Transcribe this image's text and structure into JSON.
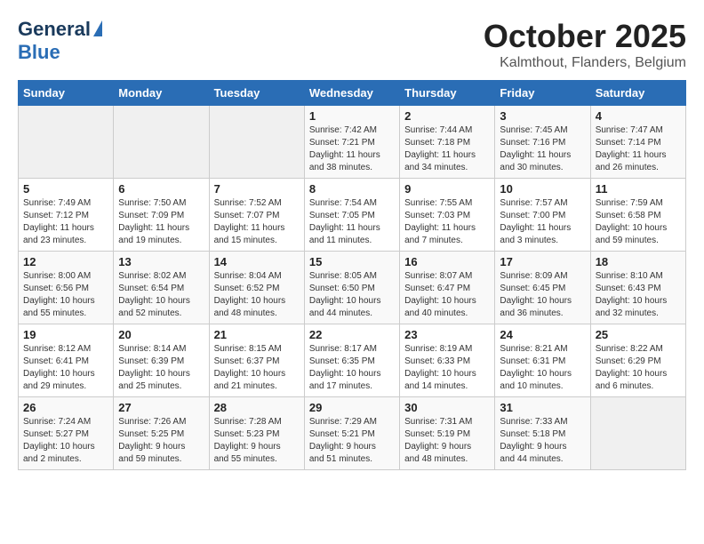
{
  "header": {
    "logo_line1": "General",
    "logo_line2": "Blue",
    "month": "October 2025",
    "location": "Kalmthout, Flanders, Belgium"
  },
  "weekdays": [
    "Sunday",
    "Monday",
    "Tuesday",
    "Wednesday",
    "Thursday",
    "Friday",
    "Saturday"
  ],
  "weeks": [
    [
      {
        "day": "",
        "info": ""
      },
      {
        "day": "",
        "info": ""
      },
      {
        "day": "",
        "info": ""
      },
      {
        "day": "1",
        "info": "Sunrise: 7:42 AM\nSunset: 7:21 PM\nDaylight: 11 hours\nand 38 minutes."
      },
      {
        "day": "2",
        "info": "Sunrise: 7:44 AM\nSunset: 7:18 PM\nDaylight: 11 hours\nand 34 minutes."
      },
      {
        "day": "3",
        "info": "Sunrise: 7:45 AM\nSunset: 7:16 PM\nDaylight: 11 hours\nand 30 minutes."
      },
      {
        "day": "4",
        "info": "Sunrise: 7:47 AM\nSunset: 7:14 PM\nDaylight: 11 hours\nand 26 minutes."
      }
    ],
    [
      {
        "day": "5",
        "info": "Sunrise: 7:49 AM\nSunset: 7:12 PM\nDaylight: 11 hours\nand 23 minutes."
      },
      {
        "day": "6",
        "info": "Sunrise: 7:50 AM\nSunset: 7:09 PM\nDaylight: 11 hours\nand 19 minutes."
      },
      {
        "day": "7",
        "info": "Sunrise: 7:52 AM\nSunset: 7:07 PM\nDaylight: 11 hours\nand 15 minutes."
      },
      {
        "day": "8",
        "info": "Sunrise: 7:54 AM\nSunset: 7:05 PM\nDaylight: 11 hours\nand 11 minutes."
      },
      {
        "day": "9",
        "info": "Sunrise: 7:55 AM\nSunset: 7:03 PM\nDaylight: 11 hours\nand 7 minutes."
      },
      {
        "day": "10",
        "info": "Sunrise: 7:57 AM\nSunset: 7:00 PM\nDaylight: 11 hours\nand 3 minutes."
      },
      {
        "day": "11",
        "info": "Sunrise: 7:59 AM\nSunset: 6:58 PM\nDaylight: 10 hours\nand 59 minutes."
      }
    ],
    [
      {
        "day": "12",
        "info": "Sunrise: 8:00 AM\nSunset: 6:56 PM\nDaylight: 10 hours\nand 55 minutes."
      },
      {
        "day": "13",
        "info": "Sunrise: 8:02 AM\nSunset: 6:54 PM\nDaylight: 10 hours\nand 52 minutes."
      },
      {
        "day": "14",
        "info": "Sunrise: 8:04 AM\nSunset: 6:52 PM\nDaylight: 10 hours\nand 48 minutes."
      },
      {
        "day": "15",
        "info": "Sunrise: 8:05 AM\nSunset: 6:50 PM\nDaylight: 10 hours\nand 44 minutes."
      },
      {
        "day": "16",
        "info": "Sunrise: 8:07 AM\nSunset: 6:47 PM\nDaylight: 10 hours\nand 40 minutes."
      },
      {
        "day": "17",
        "info": "Sunrise: 8:09 AM\nSunset: 6:45 PM\nDaylight: 10 hours\nand 36 minutes."
      },
      {
        "day": "18",
        "info": "Sunrise: 8:10 AM\nSunset: 6:43 PM\nDaylight: 10 hours\nand 32 minutes."
      }
    ],
    [
      {
        "day": "19",
        "info": "Sunrise: 8:12 AM\nSunset: 6:41 PM\nDaylight: 10 hours\nand 29 minutes."
      },
      {
        "day": "20",
        "info": "Sunrise: 8:14 AM\nSunset: 6:39 PM\nDaylight: 10 hours\nand 25 minutes."
      },
      {
        "day": "21",
        "info": "Sunrise: 8:15 AM\nSunset: 6:37 PM\nDaylight: 10 hours\nand 21 minutes."
      },
      {
        "day": "22",
        "info": "Sunrise: 8:17 AM\nSunset: 6:35 PM\nDaylight: 10 hours\nand 17 minutes."
      },
      {
        "day": "23",
        "info": "Sunrise: 8:19 AM\nSunset: 6:33 PM\nDaylight: 10 hours\nand 14 minutes."
      },
      {
        "day": "24",
        "info": "Sunrise: 8:21 AM\nSunset: 6:31 PM\nDaylight: 10 hours\nand 10 minutes."
      },
      {
        "day": "25",
        "info": "Sunrise: 8:22 AM\nSunset: 6:29 PM\nDaylight: 10 hours\nand 6 minutes."
      }
    ],
    [
      {
        "day": "26",
        "info": "Sunrise: 7:24 AM\nSunset: 5:27 PM\nDaylight: 10 hours\nand 2 minutes."
      },
      {
        "day": "27",
        "info": "Sunrise: 7:26 AM\nSunset: 5:25 PM\nDaylight: 9 hours\nand 59 minutes."
      },
      {
        "day": "28",
        "info": "Sunrise: 7:28 AM\nSunset: 5:23 PM\nDaylight: 9 hours\nand 55 minutes."
      },
      {
        "day": "29",
        "info": "Sunrise: 7:29 AM\nSunset: 5:21 PM\nDaylight: 9 hours\nand 51 minutes."
      },
      {
        "day": "30",
        "info": "Sunrise: 7:31 AM\nSunset: 5:19 PM\nDaylight: 9 hours\nand 48 minutes."
      },
      {
        "day": "31",
        "info": "Sunrise: 7:33 AM\nSunset: 5:18 PM\nDaylight: 9 hours\nand 44 minutes."
      },
      {
        "day": "",
        "info": ""
      }
    ]
  ]
}
